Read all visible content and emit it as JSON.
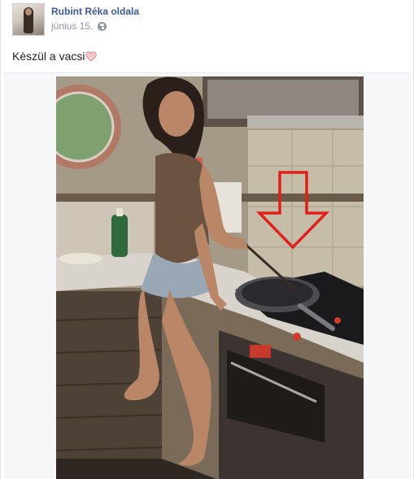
{
  "post": {
    "page_name": "Rubint Réka oldala",
    "timestamp": "június 15.",
    "privacy_icon": "globe-icon",
    "status_text": "Kèszül a vacsi",
    "emoji_icon": "heart-icon"
  },
  "photo": {
    "annotation_icon": "red-down-arrow-icon"
  },
  "colors": {
    "link": "#3b5998",
    "meta": "#90949c",
    "text": "#1d2129",
    "heart": "#e38a8f",
    "arrow": "#e0201b"
  }
}
